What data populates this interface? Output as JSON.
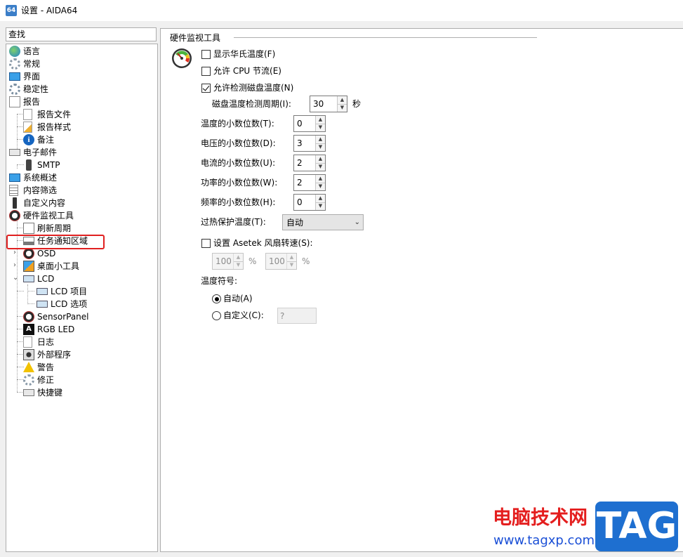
{
  "window": {
    "icon_text": "64",
    "title": "设置 - AIDA64"
  },
  "search": {
    "label": "查找"
  },
  "tree": {
    "items": [
      {
        "label": "语言",
        "icon": "globe-icon"
      },
      {
        "label": "常规",
        "icon": "gears-icon"
      },
      {
        "label": "界面",
        "icon": "monitor-icon"
      },
      {
        "label": "稳定性",
        "icon": "gear-icon"
      },
      {
        "label": "报告",
        "icon": "report-icon"
      },
      {
        "label": "报告文件",
        "icon": "document-icon"
      },
      {
        "label": "报告样式",
        "icon": "pencil-document-icon"
      },
      {
        "label": "备注",
        "icon": "info-icon"
      },
      {
        "label": "电子邮件",
        "icon": "keyboard-icon"
      },
      {
        "label": "SMTP",
        "icon": "phone-icon"
      },
      {
        "label": "系统概述",
        "icon": "monitor-icon"
      },
      {
        "label": "内容筛选",
        "icon": "filter-list-icon"
      },
      {
        "label": "自定义内容",
        "icon": "usb-icon"
      },
      {
        "label": "硬件监视工具",
        "icon": "gauge-icon"
      },
      {
        "label": "刷新周期",
        "icon": "magnifier-icon"
      },
      {
        "label": "任务通知区域",
        "icon": "taskbar-icon"
      },
      {
        "label": "OSD",
        "icon": "gauge-icon"
      },
      {
        "label": "桌面小工具",
        "icon": "desktop-gadget-icon"
      },
      {
        "label": "LCD",
        "icon": "lcd-icon"
      },
      {
        "label": "LCD 项目",
        "icon": "lcd-icon"
      },
      {
        "label": "LCD 选项",
        "icon": "lcd-icon"
      },
      {
        "label": "SensorPanel",
        "icon": "gauge-icon"
      },
      {
        "label": "RGB LED",
        "icon": "rgb-led-icon"
      },
      {
        "label": "日志",
        "icon": "document-icon"
      },
      {
        "label": "外部程序",
        "icon": "program-icon"
      },
      {
        "label": "警告",
        "icon": "warning-icon"
      },
      {
        "label": "修正",
        "icon": "gears-icon"
      },
      {
        "label": "快捷键",
        "icon": "keyboard-icon"
      }
    ]
  },
  "panel": {
    "title": "硬件监视工具",
    "fahrenheit": {
      "label": "显示华氏温度(F)",
      "checked": false
    },
    "cpu_throttle": {
      "label": "允许 CPU 节流(E)",
      "checked": false
    },
    "disk_temp": {
      "label": "允许检测磁盘温度(N)",
      "checked": true
    },
    "disk_period": {
      "label": "磁盘温度检测周期(I):",
      "value": "30",
      "unit": "秒"
    },
    "temp_decimals": {
      "label": "温度的小数位数(T):",
      "value": "0"
    },
    "voltage_decimals": {
      "label": "电压的小数位数(D):",
      "value": "3"
    },
    "current_decimals": {
      "label": "电流的小数位数(U):",
      "value": "2"
    },
    "power_decimals": {
      "label": "功率的小数位数(W):",
      "value": "2"
    },
    "freq_decimals": {
      "label": "频率的小数位数(H):",
      "value": "0"
    },
    "overheat": {
      "label": "过热保护温度(T):",
      "selected": "自动"
    },
    "asetek": {
      "label": "设置 Asetek 风扇转速(S):",
      "checked": false,
      "value1": "100",
      "unit1": "%",
      "value2": "100",
      "unit2": "%"
    },
    "temp_symbol": {
      "label": "温度符号:",
      "auto_label": "自动(A)",
      "custom_label": "自定义(C):",
      "custom_value": "?",
      "selected": "auto"
    }
  },
  "watermark": {
    "text": "电脑技术网",
    "url": "www.tagxp.com",
    "logo": "TAG"
  },
  "colors": {
    "highlight": "#e02020",
    "accent": "#1e6fd0",
    "watermark_red": "#e41e1e"
  }
}
